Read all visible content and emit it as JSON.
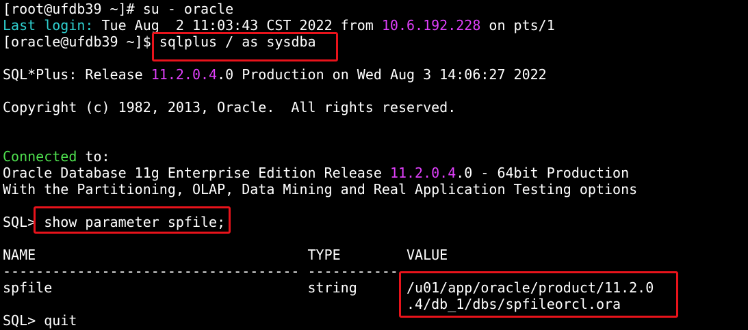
{
  "terminal": {
    "root_prompt": "[root@ufdb39 ~]# ",
    "su_command": "su - oracle",
    "last_login_label": "Last login:",
    "last_login_date": " Tue Aug  2 11:03:43 CST 2022 from ",
    "last_login_ip": "10.6.192.228",
    "last_login_tty": " on pts/1",
    "oracle_prompt": "[oracle@ufdb39 ~]$ ",
    "sqlplus_command": "sqlplus / as sysdba",
    "release_prefix": "SQL*Plus: Release ",
    "release_version": "11.2.0.4",
    "release_suffix": ".0 Production on Wed Aug 3 14:06:27 2022",
    "copyright": "Copyright (c) 1982, 2013, Oracle.  All rights reserved.",
    "connected_word": "Connected",
    "connected_to": " to:",
    "db_prefix": "Oracle Database 11g Enterprise Edition Release ",
    "db_version": "11.2.0.4",
    "db_suffix": ".0 - 64bit Production",
    "options_line": "With the Partitioning, OLAP, Data Mining and Real Application Testing options",
    "sql_prompt": "SQL> ",
    "show_command": "show parameter spfile;",
    "header_line": "NAME                                 TYPE        VALUE",
    "dash_line": "------------------------------------ ----------- ",
    "row_name_type": "spfile                               string      ",
    "row_value_1": "/u01/app/oracle/product/11.2.0",
    "row_value_2": ".4/db_1/dbs/spfileorcl.ora",
    "row_value_indent": "                                                 ",
    "quit_command": "quit"
  }
}
